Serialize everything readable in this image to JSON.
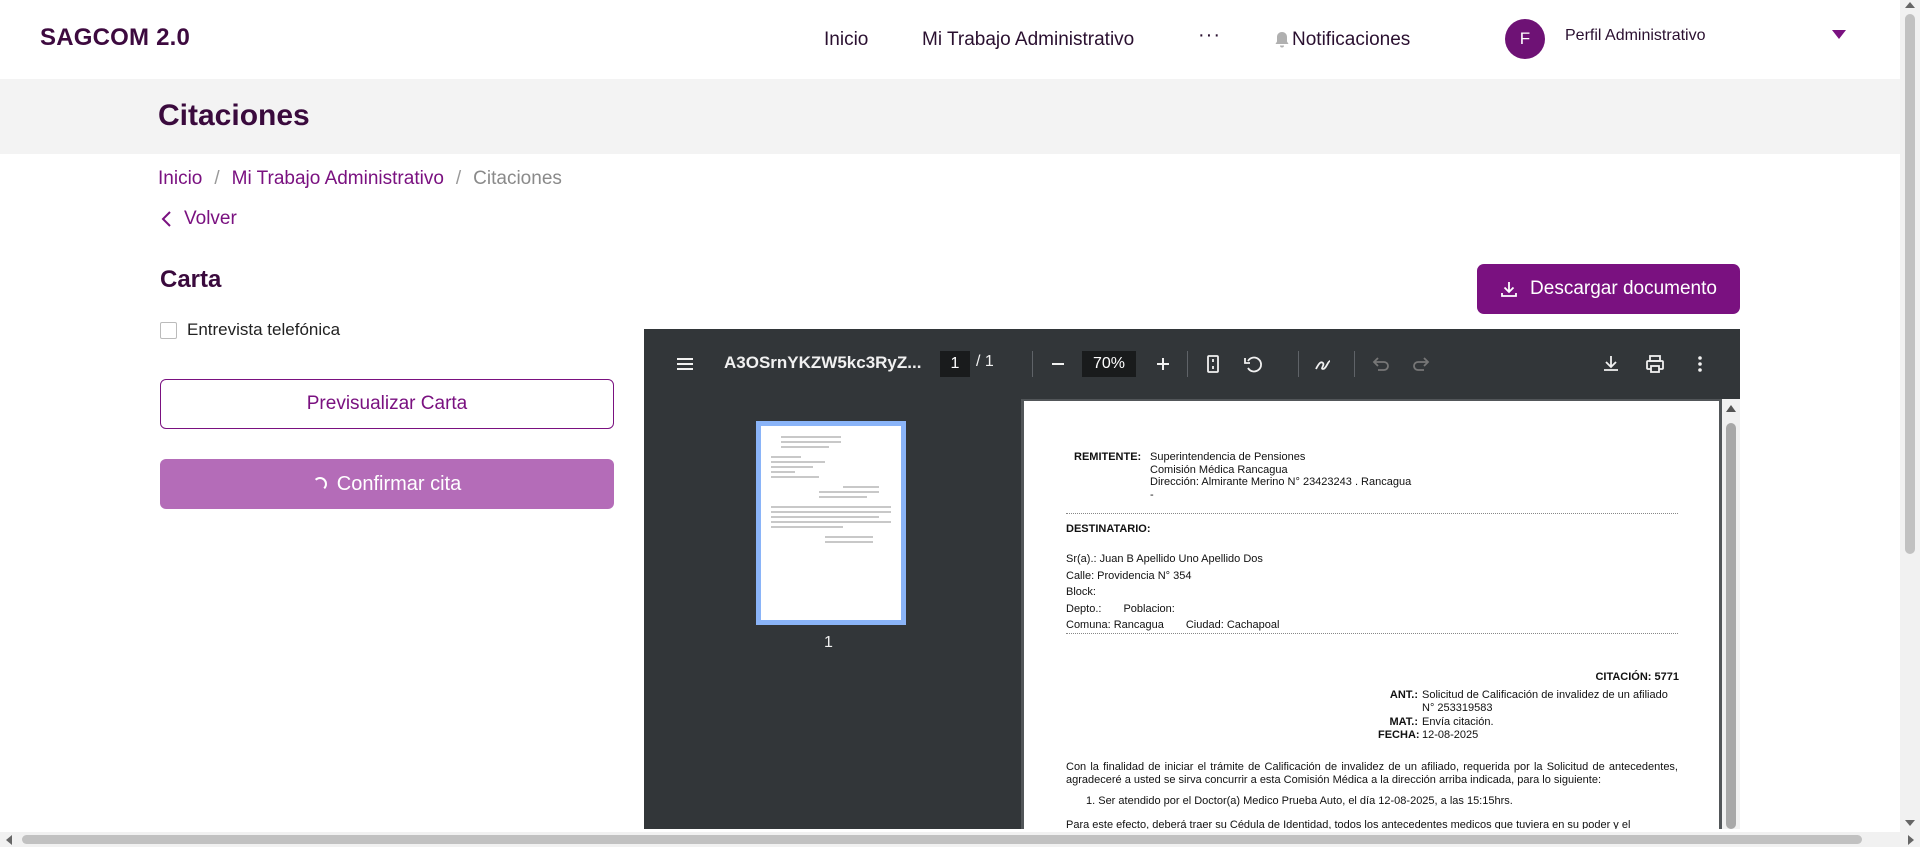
{
  "header": {
    "brand": "SAGCOM 2.0",
    "nav": {
      "inicio": "Inicio",
      "trabajo": "Mi Trabajo Administrativo",
      "more": "···",
      "notificaciones": "Notificaciones"
    },
    "avatar_initial": "F",
    "profile_name": "Perfil Administrativo"
  },
  "page": {
    "title": "Citaciones",
    "breadcrumb": [
      "Inicio",
      "Mi Trabajo Administrativo",
      "Citaciones"
    ],
    "breadcrumb_sep": "/",
    "back_label": "Volver",
    "section_title": "Carta",
    "checkbox_label": "Entrevista telefónica",
    "checkbox_checked": false,
    "preview_button": "Previsualizar Carta",
    "confirm_button": "Confirmar cita",
    "download_button": "Descargar documento"
  },
  "viewer": {
    "doc_name": "A3OSrnYKZW5kc3RyZ...",
    "current_page": "1",
    "page_total": "/  1",
    "zoom": "70%",
    "thumb_number": "1"
  },
  "letter": {
    "remitente_label": "REMITENTE:",
    "remitente_lines": [
      "Superintendencia de Pensiones",
      "Comisión Médica Rancagua",
      "Dirección: Almirante Merino N° 23423243 . Rancagua",
      "-"
    ],
    "destinatario_label": "DESTINATARIO:",
    "dest_nombre": "Sr(a).: Juan B Apellido Uno Apellido Dos",
    "dest_calle": "Calle: Providencia N° 354",
    "dest_block": "Block:",
    "dest_depto": "Depto.:",
    "dest_poblacion": "Poblacion:",
    "dest_comuna": "Comuna: Rancagua",
    "dest_ciudad": "Ciudad: Cachapoal",
    "citacion": "CITACIÓN: 5771",
    "ant_label": "ANT.:",
    "ant_value": "Solicitud de Calificación de invalidez de un afiliado N° 253319583",
    "mat_label": "MAT.:",
    "mat_value": "Envía citación.",
    "fecha_label": "FECHA:",
    "fecha_value": "12-08-2025",
    "paragraph": "Con la finalidad de iniciar el trámite de Calificación de invalidez de un afiliado, requerida por la Solicitud de antecedentes, agradeceré a usted se sirva concurrir a esta Comisión Médica a la dirección arriba indicada, para lo siguiente:",
    "item1": "1.   Ser atendido por el Doctor(a) Medico Prueba Auto, el día 12-08-2025, a las 15:15hrs.",
    "paragraph2": "Para este efecto, deberá traer su Cédula de Identidad, todos los antecedentes medicos que tuviera en su poder y el comprobante"
  },
  "colors": {
    "brand": "#3d0a3f",
    "accent": "#7a1180",
    "confirm_disabled": "#b46cb8",
    "viewer_toolbar": "#323639"
  },
  "icons": {
    "bell": "bell-icon",
    "caret": "chevron-down-icon",
    "back": "chevron-left-icon",
    "download": "download-icon",
    "menu": "menu-icon",
    "zoom_out": "minus-icon",
    "zoom_in": "plus-icon",
    "fit": "fit-page-icon",
    "rotate": "rotate-icon",
    "annotate": "pen-icon",
    "undo": "undo-icon",
    "redo": "redo-icon",
    "print": "print-icon",
    "more": "more-vert-icon"
  }
}
